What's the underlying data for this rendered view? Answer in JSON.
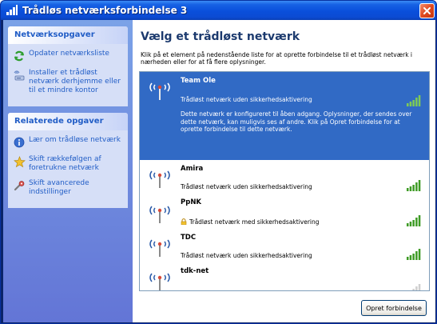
{
  "window": {
    "title": "Trådløs netværksforbindelse 3"
  },
  "sidebar": {
    "network_tasks": {
      "heading": "Netværksopgaver",
      "items": [
        {
          "label": "Opdater netværksliste",
          "icon": "refresh-icon"
        },
        {
          "label": "Installer et trådløst netværk derhjemme eller til et mindre kontor",
          "icon": "setup-wireless-icon"
        }
      ]
    },
    "related_tasks": {
      "heading": "Relaterede opgaver",
      "items": [
        {
          "label": "Lær om trådløse netværk",
          "icon": "info-icon"
        },
        {
          "label": "Skift rækkefølgen af foretrukne netværk",
          "icon": "star-icon"
        },
        {
          "label": "Skift avancerede indstillinger",
          "icon": "settings-icon"
        }
      ]
    }
  },
  "main": {
    "heading": "Vælg et trådløst netværk",
    "instructions": "Klik på et element på nedenstående liste for at oprette forbindelse til et trådløst netværk i nærheden eller for at få flere oplysninger.",
    "networks": [
      {
        "name": "Team Ole",
        "status": "Trådløst netværk uden sikkerhedsaktivering",
        "secured": false,
        "selected": true,
        "signal_bars": 5,
        "description": "Dette netværk er konfigureret til åben adgang. Oplysninger, der sendes over dette netværk, kan muligvis ses af andre. Klik på Opret forbindelse for at oprette forbindelse til dette netværk."
      },
      {
        "name": "Amira",
        "status": "Trådløst netværk uden sikkerhedsaktivering",
        "secured": false,
        "selected": false,
        "signal_bars": 5
      },
      {
        "name": "PpNK",
        "status": "Trådløst netværk med sikkerhedsaktivering",
        "secured": true,
        "selected": false,
        "signal_bars": 5
      },
      {
        "name": "TDC",
        "status": "Trådløst netværk uden sikkerhedsaktivering",
        "secured": false,
        "selected": false,
        "signal_bars": 5
      },
      {
        "name": "tdk-net",
        "status": "",
        "secured": false,
        "selected": false,
        "signal_bars": 1
      }
    ],
    "connect_button": "Opret forbindelse"
  },
  "colors": {
    "titlebar": "#0a4fdb",
    "sidebar": "#6f8ede",
    "selection": "#316ac5",
    "signal": "#4caf2c"
  }
}
